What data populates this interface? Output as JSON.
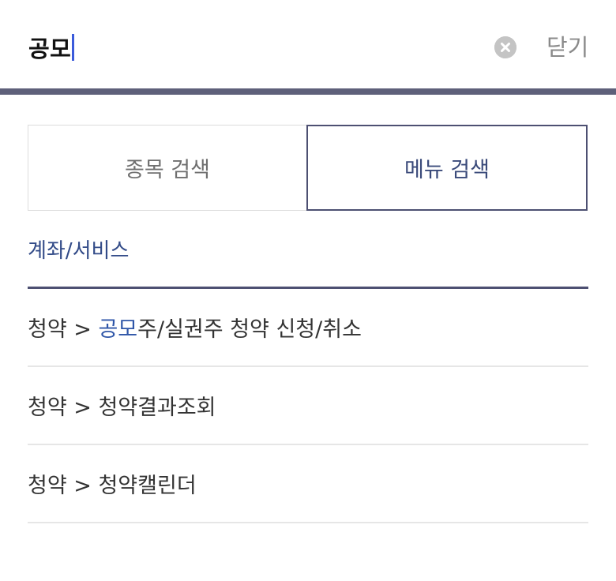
{
  "search": {
    "query": "공모",
    "close_label": "닫기"
  },
  "tabs": [
    {
      "label": "종목 검색",
      "active": false
    },
    {
      "label": "메뉴 검색",
      "active": true
    }
  ],
  "section": {
    "title": "계좌/서비스"
  },
  "results": [
    {
      "prefix": "청약 > ",
      "highlight": "공모",
      "rest": "주/실권주 청약 신청/취소"
    },
    {
      "prefix": "청약 > ",
      "highlight": "",
      "rest": "청약결과조회"
    },
    {
      "prefix": "청약 > ",
      "highlight": "",
      "rest": "청약캘린더"
    }
  ],
  "colors": {
    "accent": "#324b88",
    "highlight": "#2f56a8",
    "divider": "#5e607a",
    "caret": "#3b5bdb"
  },
  "icons": {
    "clear": "clear-circle-x-icon"
  }
}
